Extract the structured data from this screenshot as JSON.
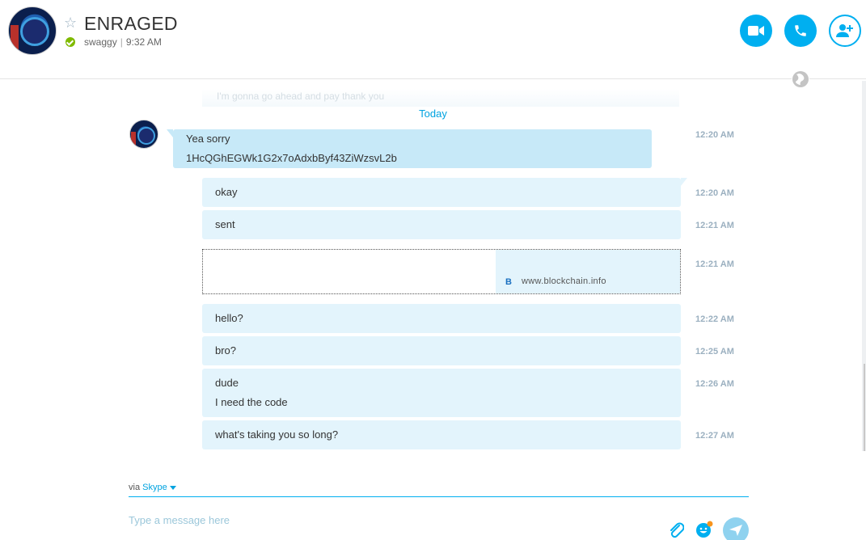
{
  "header": {
    "contact_name": "ENRAGED",
    "mood_text": "swaggy",
    "local_time": "9:32 AM",
    "separator": "|"
  },
  "conversation": {
    "faded_previous": "I'm gonna go ahead and pay thank you",
    "date_separator": "Today",
    "incoming": {
      "lines": [
        "Yea sorry",
        "1HcQGhEGWk1G2x7oAdxbByf43ZiWzsvL2b"
      ],
      "time": "12:20 AM"
    },
    "outgoing": [
      {
        "text": "okay",
        "time": "12:20 AM"
      },
      {
        "text": "sent",
        "time": "12:21 AM"
      }
    ],
    "link_card": {
      "logo_letter": "B",
      "domain": "www.blockchain.info",
      "time": "12:21 AM"
    },
    "outgoing_after": [
      {
        "lines": [
          "hello?"
        ],
        "time": "12:22 AM"
      },
      {
        "lines": [
          "bro?"
        ],
        "time": "12:25 AM"
      },
      {
        "lines": [
          "dude",
          "I need the code"
        ],
        "time": "12:26 AM"
      },
      {
        "lines": [
          "what's taking you so long?"
        ],
        "time": "12:27 AM"
      }
    ]
  },
  "composer": {
    "via_label": "via",
    "via_service": "Skype",
    "placeholder": "Type a message here",
    "value": ""
  },
  "colors": {
    "accent": "#00aff0",
    "incoming_bubble": "#c7e9f8",
    "outgoing_bubble": "#e3f4fc",
    "online": "#7fba00"
  },
  "icons": {
    "favorite": "star-icon",
    "video_call": "video-camera-icon",
    "audio_call": "phone-icon",
    "add_people": "add-person-icon",
    "translator": "globe-icon",
    "attach": "paperclip-icon",
    "emoticons": "emoji-icon",
    "send": "send-icon"
  }
}
